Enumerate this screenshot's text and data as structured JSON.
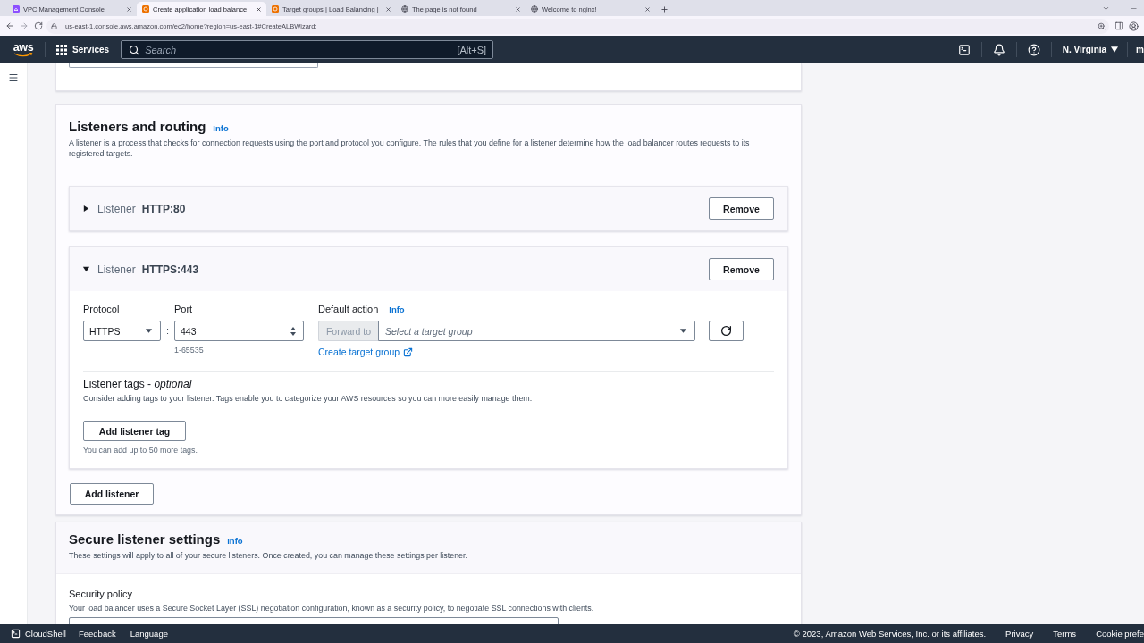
{
  "browser": {
    "tabs": [
      {
        "title": "VPC Management Console",
        "kind": "square",
        "selected": false
      },
      {
        "title": "Create application load balance",
        "kind": "square-orange",
        "selected": true
      },
      {
        "title": "Target groups | Load Balancing |",
        "kind": "square-orange",
        "selected": false
      },
      {
        "title": "The page is not found",
        "kind": "globe",
        "selected": false
      },
      {
        "title": "Welcome to nginx!",
        "kind": "globe",
        "selected": false
      }
    ],
    "url": "us-east-1.console.aws.amazon.com/ec2/home?region=us-east-1#CreateALBWizard:"
  },
  "header": {
    "logo": "aws",
    "services": "Services",
    "search": {
      "placeholder": "Search",
      "shortcut": "[Alt+S]"
    },
    "region": "N. Virginia",
    "account": "m"
  },
  "listeners_section": {
    "title": "Listeners and routing",
    "info": "Info",
    "description": "A listener is a process that checks for connection requests using the port and protocol you configure. The rules that you define for a listener determine how the load balancer routes requests to its registered targets.",
    "listeners": [
      {
        "label": "Listener",
        "name": "HTTP:80",
        "expanded": false,
        "remove_button": "Remove"
      },
      {
        "label": "Listener",
        "name": "HTTPS:443",
        "expanded": true,
        "remove_button": "Remove",
        "protocol": {
          "label": "Protocol",
          "value": "HTTPS"
        },
        "separator": ":",
        "port": {
          "label": "Port",
          "value": "443",
          "hint": "1-65535"
        },
        "default_action": {
          "label": "Default action",
          "info": "Info",
          "prefix": "Forward to",
          "placeholder": "Select a target group",
          "link": "Create target group"
        },
        "tags": {
          "title": "Listener tags - *optional*",
          "description": "Consider adding tags to your listener. Tags enable you to categorize your AWS resources so you can more easily manage them.",
          "button": "Add listener tag",
          "hint": "You can add up to 50 more tags."
        }
      }
    ],
    "add_button": "Add listener"
  },
  "secure_section": {
    "title": "Secure listener settings",
    "info": "Info",
    "description": "These settings will apply to all of your secure listeners. Once created, you can manage these settings per listener.",
    "security_policy": {
      "label": "Security policy",
      "description": "Your load balancer uses a Secure Socket Layer (SSL) negotiation configuration, known as a security policy, to negotiate SSL connections with clients."
    }
  },
  "footer": {
    "cloudshell": "CloudShell",
    "links": [
      "Feedback",
      "Language"
    ],
    "copyright": "© 2023, Amazon Web Services, Inc. or its affiliates.",
    "legal_links": [
      "Privacy",
      "Terms",
      "Cookie prefe"
    ]
  }
}
